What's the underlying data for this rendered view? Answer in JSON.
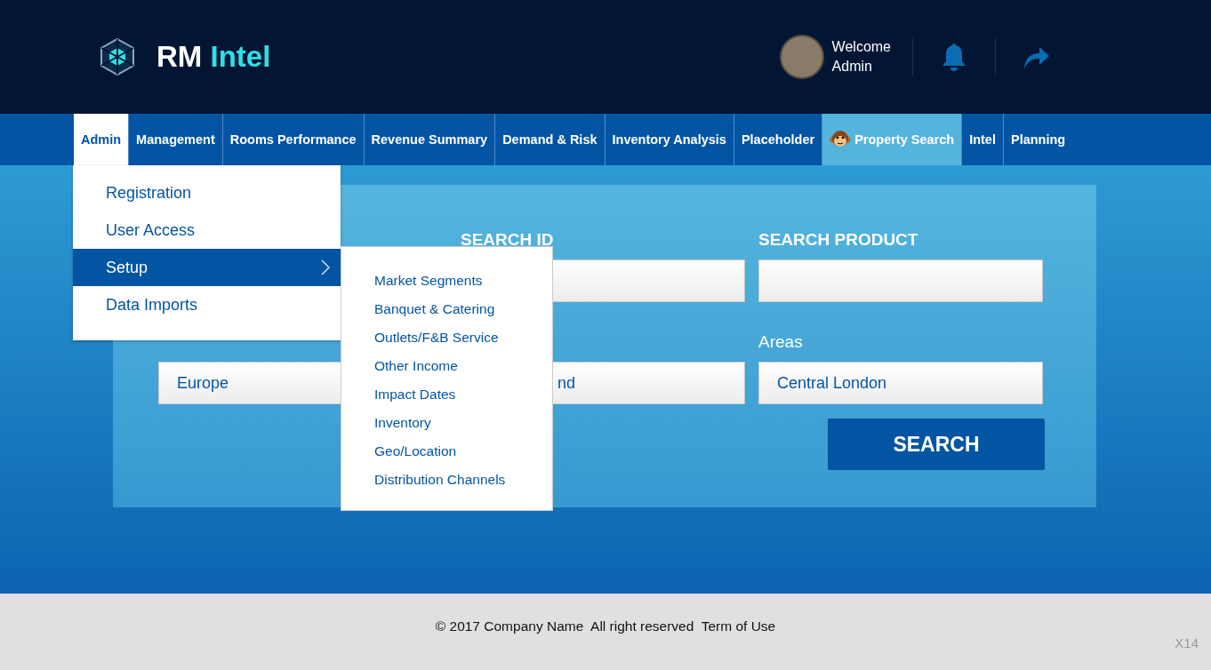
{
  "header": {
    "brand_main": "RM",
    "brand_accent": "Intel",
    "welcome": "Welcome",
    "user": "Admin"
  },
  "tabs": [
    {
      "label": "Admin",
      "selected": true,
      "highlighted": false
    },
    {
      "label": "Management",
      "selected": false,
      "highlighted": false
    },
    {
      "label": "Rooms Performance",
      "selected": false,
      "highlighted": false
    },
    {
      "label": "Revenue Summary",
      "selected": false,
      "highlighted": false
    },
    {
      "label": "Demand & Risk",
      "selected": false,
      "highlighted": false
    },
    {
      "label": "Inventory Analysis",
      "selected": false,
      "highlighted": false
    },
    {
      "label": "Placeholder",
      "selected": false,
      "highlighted": false
    },
    {
      "label": "Property Search",
      "selected": false,
      "highlighted": true
    },
    {
      "label": "Intel",
      "selected": false,
      "highlighted": false
    },
    {
      "label": "Planning",
      "selected": false,
      "highlighted": false
    }
  ],
  "admin_menu": [
    {
      "label": "Registration",
      "selected": false
    },
    {
      "label": "User Access",
      "selected": false
    },
    {
      "label": "Setup",
      "selected": true,
      "children": [
        {
          "label": "Market Segments"
        },
        {
          "label": "Banquet & Catering"
        },
        {
          "label": "Outlets/F&B Service"
        },
        {
          "label": "Other Income"
        },
        {
          "label": "Impact Dates"
        },
        {
          "label": "Inventory"
        },
        {
          "label": "Geo/Location"
        },
        {
          "label": "Distribution Channels"
        }
      ]
    },
    {
      "label": "Data Imports",
      "selected": false
    }
  ],
  "search_form": {
    "rows": [
      [
        null,
        {
          "label": "SEARCH ID"
        },
        {
          "label": "SEARCH PRODUCT"
        }
      ],
      [
        {
          "value": "Europe"
        },
        {
          "value": "nd",
          "kind": "offset"
        },
        {
          "label": "Areas",
          "value": "Central London",
          "kind": "plain"
        }
      ]
    ],
    "button": "SEARCH"
  },
  "footer": {
    "text": "© 2017 Company Name  All right reserved  Term of Use",
    "tag": "X14"
  }
}
